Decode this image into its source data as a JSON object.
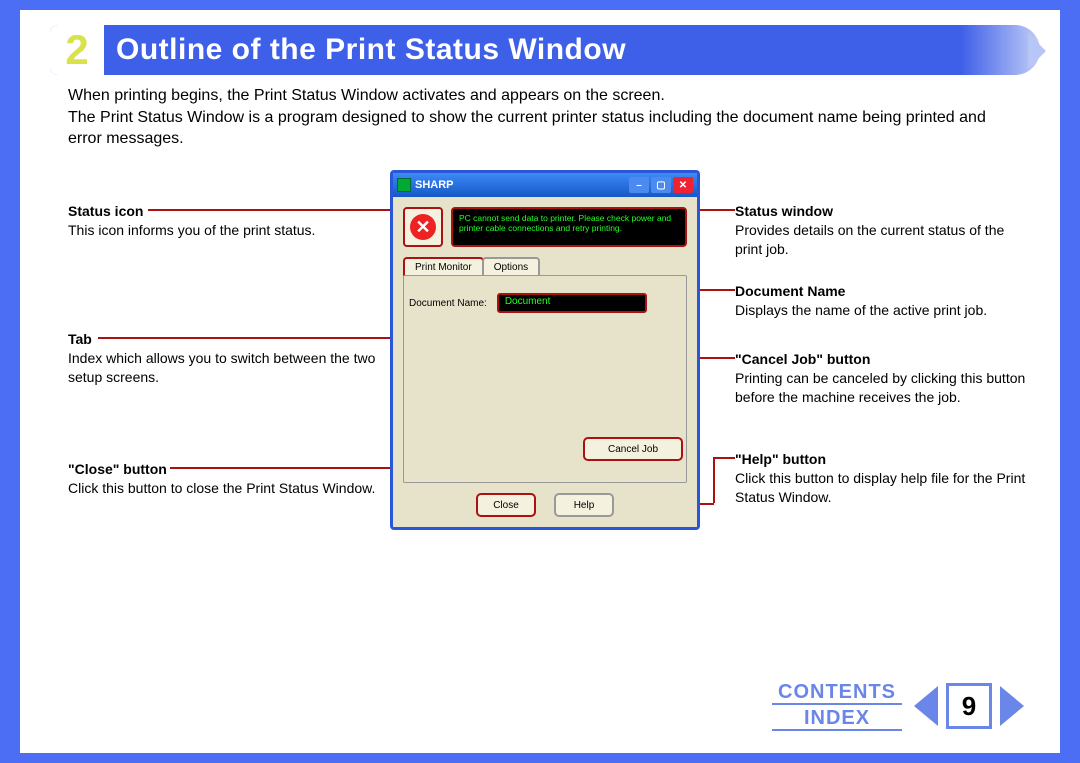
{
  "banner": {
    "number": "2",
    "title": "Outline of the Print Status Window"
  },
  "intro": {
    "p1": "When printing begins, the Print Status Window activates and appears on the screen.",
    "p2": "The Print Status Window is a program designed to show the current printer status including the document name being printed and error messages."
  },
  "callouts": {
    "status_icon": {
      "title": "Status icon",
      "desc": "This icon informs you of the print status."
    },
    "tab": {
      "title": "Tab",
      "desc": "Index which allows you to switch between the two setup screens."
    },
    "close": {
      "title": "\"Close\" button",
      "desc": "Click this button to close the Print Status Window."
    },
    "status_win": {
      "title": "Status window",
      "desc": "Provides details on the current status of the print job."
    },
    "docname": {
      "title": "Document Name",
      "desc": "Displays the name of the active print job."
    },
    "cancel": {
      "title": "\"Cancel Job\" button",
      "desc": "Printing can be canceled by clicking this button before the machine receives the job."
    },
    "help": {
      "title": "\"Help\" button",
      "desc": "Click this button to display help file for the Print Status Window."
    }
  },
  "window": {
    "title": "SHARP",
    "status_text": "PC cannot send data to printer. Please check power and printer cable connections and retry printing.",
    "tabs": {
      "active": "Print Monitor",
      "inactive": "Options"
    },
    "doc_label": "Document Name:",
    "doc_value": "Document",
    "cancel_label": "Cancel Job",
    "close_label": "Close",
    "help_label": "Help"
  },
  "footer": {
    "contents": "CONTENTS",
    "index": "INDEX",
    "page": "9"
  }
}
